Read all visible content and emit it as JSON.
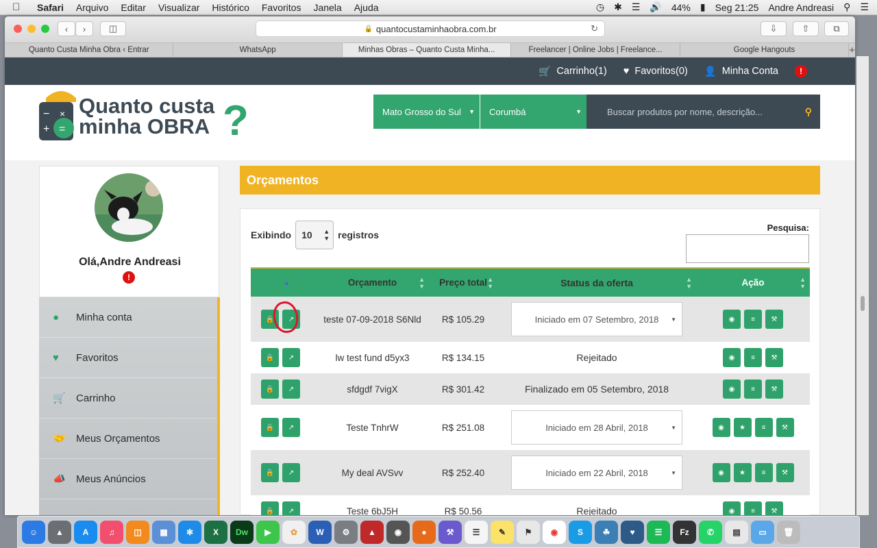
{
  "menubar": {
    "app": "Safari",
    "items": [
      "Arquivo",
      "Editar",
      "Visualizar",
      "Histórico",
      "Favoritos",
      "Janela",
      "Ajuda"
    ],
    "battery": "44%",
    "clock": "Seg 21:25",
    "user": "Andre Andreasi"
  },
  "browser": {
    "url": "quantocustaminhaobra.com.br",
    "tabs": [
      {
        "label": "Quanto Custa Minha Obra ‹ Entrar"
      },
      {
        "label": "WhatsApp"
      },
      {
        "label": "Minhas Obras – Quanto Custa Minha..."
      },
      {
        "label": "Freelancer | Online Jobs | Freelance..."
      },
      {
        "label": "Google Hangouts"
      }
    ],
    "new_tab": "+"
  },
  "topnav": {
    "cart": "Carrinho(1)",
    "favorites": "Favoritos(0)",
    "account": "Minha Conta",
    "alert": "!"
  },
  "header": {
    "logo_line1": "Quanto custa",
    "logo_line2": "minha OBRA",
    "state": "Mato Grosso do Sul",
    "city": "Corumbá",
    "search_placeholder": "Buscar produtos por nome, descrição..."
  },
  "profile": {
    "greeting": "Olá,Andre Andreasi",
    "alert": "!"
  },
  "sidebar": {
    "items": [
      {
        "label": "Minha conta",
        "icon": "user-icon"
      },
      {
        "label": "Favoritos",
        "icon": "heart-icon"
      },
      {
        "label": "Carrinho",
        "icon": "cart-icon"
      },
      {
        "label": "Meus Orçamentos",
        "icon": "handshake-icon"
      },
      {
        "label": "Meus Anúncios",
        "icon": "megaphone-icon"
      }
    ]
  },
  "main": {
    "title": "Orçamentos",
    "showing_prefix": "Exibindo",
    "page_size": "10",
    "showing_suffix": "registros",
    "search_label": "Pesquisa:",
    "columns": [
      "",
      "Orçamento",
      "Preço total",
      "Status da oferta",
      "Ação"
    ],
    "rows": [
      {
        "name": "teste 07-09-2018 S6Nld",
        "price": "R$ 105.29",
        "status": "Iniciado em 07 Setembro, 2018",
        "status_select": true,
        "actions": [
          "eye",
          "list",
          "wrench"
        ]
      },
      {
        "name": "lw test fund d5yx3",
        "price": "R$ 134.15",
        "status": "Rejeitado",
        "status_select": false,
        "actions": [
          "eye",
          "list",
          "wrench"
        ]
      },
      {
        "name": "sfdgdf 7vigX",
        "price": "R$ 301.42",
        "status": "Finalizado em 05 Setembro, 2018",
        "status_select": false,
        "actions": [
          "eye",
          "list",
          "wrench"
        ]
      },
      {
        "name": "Teste TnhrW",
        "price": "R$ 251.08",
        "status": "Iniciado em 28 Abril, 2018",
        "status_select": true,
        "actions": [
          "eye",
          "star",
          "list",
          "wrench"
        ]
      },
      {
        "name": "My deal AVSvv",
        "price": "R$ 252.40",
        "status": "Iniciado em 22 Abril, 2018",
        "status_select": true,
        "actions": [
          "eye",
          "star",
          "list",
          "wrench"
        ]
      },
      {
        "name": "Teste 6bJ5H",
        "price": "R$ 50.56",
        "status": "Rejeitado",
        "status_select": false,
        "actions": [
          "eye",
          "list",
          "wrench"
        ]
      }
    ]
  },
  "colors": {
    "green": "#33a56e",
    "yellow": "#f0b323",
    "dark": "#3d4a54",
    "alert_red": "#e01010"
  }
}
